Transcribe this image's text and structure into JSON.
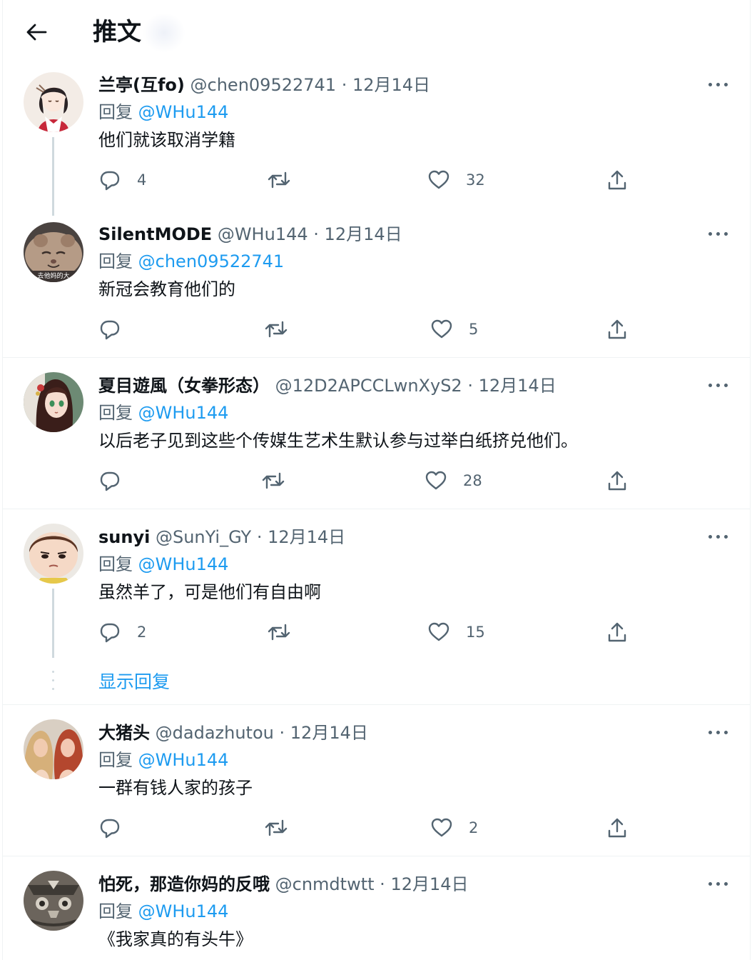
{
  "header": {
    "title": "推文"
  },
  "colors": {
    "accent": "#1d9bf0",
    "secondary_text": "#536471",
    "primary_text": "#0f1419",
    "divider": "#eff3f4",
    "thread_line": "#cfd9de"
  },
  "tweets": [
    {
      "name": "兰亭(互fo)",
      "handle": "@chen09522741",
      "dot": "·",
      "date": "12月14日",
      "reply_label": "回复 ",
      "reply_to": "@WHu144",
      "text": "他们就该取消学籍",
      "replies": "4",
      "retweets": "",
      "likes": "32"
    },
    {
      "name": "SilentMODE",
      "handle": "@WHu144",
      "dot": "·",
      "date": "12月14日",
      "reply_label": "回复 ",
      "reply_to": "@chen09522741",
      "text": "新冠会教育他们的",
      "replies": "",
      "retweets": "",
      "likes": "5",
      "avatar_caption": "去他妈的大"
    },
    {
      "name": "夏目遊風（女拳形态）",
      "handle": "@12D2APCCLwnXyS2",
      "dot": "·",
      "date": "12月14日",
      "reply_label": "回复 ",
      "reply_to": "@WHu144",
      "text": "以后老子见到这些个传媒生艺术生默认参与过举白纸挤兑他们。",
      "replies": "",
      "retweets": "",
      "likes": "28"
    },
    {
      "name": "sunyi",
      "handle": "@SunYi_GY",
      "dot": "·",
      "date": "12月14日",
      "reply_label": "回复 ",
      "reply_to": "@WHu144",
      "text": "虽然羊了，可是他们有自由啊",
      "replies": "2",
      "retweets": "",
      "likes": "15"
    },
    {
      "name": "大猪头",
      "handle": "@dadazhutou",
      "dot": "·",
      "date": "12月14日",
      "reply_label": "回复 ",
      "reply_to": "@WHu144",
      "text": "一群有钱人家的孩子",
      "replies": "",
      "retweets": "",
      "likes": "2"
    },
    {
      "name": "怕死，那造你妈的反哦",
      "handle": "@cnmdtwtt",
      "dot": "·",
      "date": "12月14日",
      "reply_label": "回复 ",
      "reply_to": "@WHu144",
      "text": "《我家真的有头牛》"
    }
  ],
  "show_replies": "显示回复",
  "icons": {
    "back": "arrow-left-icon",
    "more": "more-horizontal-icon",
    "reply": "speech-bubble-icon",
    "retweet": "retweet-icon",
    "like": "heart-icon",
    "share": "share-upload-icon"
  }
}
